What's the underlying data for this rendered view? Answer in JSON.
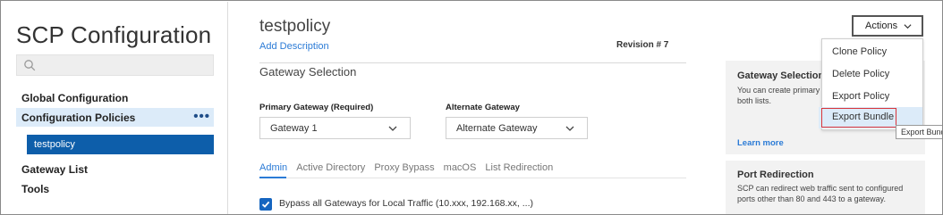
{
  "sidebar": {
    "title": "SCP Configuration",
    "search": {
      "placeholder": ""
    },
    "items": {
      "global": "Global Configuration",
      "policies": "Configuration Policies",
      "policies_more": "•••",
      "selected_policy": "testpolicy",
      "gateways": "Gateway List",
      "tools": "Tools"
    }
  },
  "main": {
    "policy_title": "testpolicy",
    "add_description": "Add Description",
    "revision": "Revision # 7",
    "section_title": "Gateway Selection",
    "primary_label": "Primary Gateway (Required)",
    "primary_value": "Gateway 1",
    "alternate_label": "Alternate Gateway",
    "alternate_value": "Alternate Gateway",
    "tabs": [
      "Admin",
      "Active Directory",
      "Proxy Bypass",
      "macOS",
      "List Redirection"
    ],
    "active_tab": "Admin",
    "bypass_label": "Bypass all Gateways for Local Traffic (10.xxx, 192.168.xx, ...)"
  },
  "actions": {
    "button_label": "Actions",
    "menu": [
      "Clone Policy",
      "Delete Policy",
      "Export Policy",
      "Export Bundle"
    ],
    "tooltip": "Export Bundle"
  },
  "right_panel": {
    "gateway_title": "Gateway Selection",
    "gateway_text": "You can create primary gateways and configure to both lists.",
    "learn_more": "Learn more",
    "port_title": "Port Redirection",
    "port_text": "SCP can redirect web traffic sent to configured ports other than 80 and 443 to a gateway."
  },
  "colors": {
    "accent": "#2b7bd6",
    "selected_bg": "#0d5eaa",
    "highlight_bg": "#dcebf9",
    "outline_red": "#d9343a"
  }
}
